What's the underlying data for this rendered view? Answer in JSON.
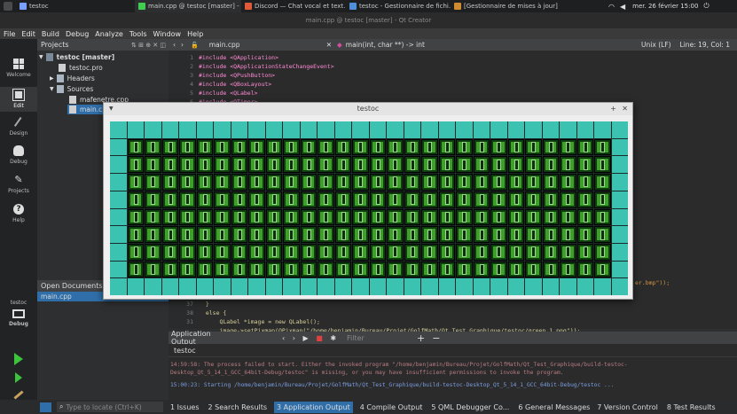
{
  "system_panel": {
    "tasks": [
      {
        "label": "testoc",
        "color": "#7aa0ff"
      },
      {
        "label": "main.cpp @ testoc [master] - ...",
        "color": "#41cd52"
      },
      {
        "label": "Discord — Chat vocal et text...",
        "color": "#e05a3a"
      },
      {
        "label": "testoc - Gestionnaire de fichi...",
        "color": "#4f8fd8"
      },
      {
        "label": "[Gestionnaire de mises à jour]",
        "color": "#d08a30"
      }
    ],
    "clock": "mer. 26 février 15:00"
  },
  "window_title": "main.cpp @ testoc [master] - Qt Creator",
  "menu": [
    "File",
    "Edit",
    "Build",
    "Debug",
    "Analyze",
    "Tools",
    "Window",
    "Help"
  ],
  "modes": [
    {
      "label": "Welcome",
      "icon": "welcome-icon"
    },
    {
      "label": "Edit",
      "icon": "edit-icon"
    },
    {
      "label": "Design",
      "icon": "design-icon"
    },
    {
      "label": "Debug",
      "icon": "debug-icon"
    },
    {
      "label": "Projects",
      "icon": "projects-icon"
    },
    {
      "label": "Help",
      "icon": "help-icon"
    }
  ],
  "kit": {
    "project": "testoc",
    "config": "Debug"
  },
  "projects_panel": {
    "title": "Projects",
    "tree": [
      "testoc [master]",
      "testoc.pro",
      "Headers",
      "Sources",
      "mafenetre.cpp",
      "main.cpp"
    ]
  },
  "open_documents": {
    "title": "Open Documents",
    "items": [
      "main.cpp"
    ]
  },
  "editor": {
    "file": "main.cpp",
    "function": "main(int, char **) -> int",
    "encoding": "Unix (LF)",
    "position": "Line: 19, Col: 1",
    "lines": [
      {
        "n": "1",
        "text": "#include <QApplication>"
      },
      {
        "n": "2",
        "text": "#include <QApplicationStateChangeEvent>"
      },
      {
        "n": "3",
        "text": "#include <QPushButton>"
      },
      {
        "n": "4",
        "text": "#include <QBoxLayout>"
      },
      {
        "n": "5",
        "text": "#include <QLabel>"
      },
      {
        "n": "6",
        "text": "#include <QTimer>"
      }
    ],
    "bottom_lines": [
      {
        "n": "",
        "text": "er.bmp\"));"
      },
      {
        "n": "37",
        "text": "  }"
      },
      {
        "n": "38",
        "text": "  else {"
      },
      {
        "n": "31",
        "text": "      QLabel *image = new QLabel();"
      },
      {
        "n": "32",
        "text": "      image->setPixmap(QPixmap(\"/home/benjamin/Bureau/Projet/GolfMath/Qt_Test_Graphique/testoc/green_1.png\"));"
      }
    ]
  },
  "output": {
    "title": "Application Output",
    "filter_placeholder": "Filter",
    "tab": "testoc",
    "lines": [
      "14:59:58: The process failed to start. Either the invoked program \"/home/benjamin/Bureau/Projet/GolfMath/Qt_Test_Graphique/build-testoc-",
      "Desktop_Qt_5_14_1_GCC_64bit-Debug/testoc\" is missing, or you may have insufficient permissions to invoke the program.",
      "15:00:23: Starting /home/benjamin/Bureau/Projet/GolfMath/Qt_Test_Graphique/build-testoc-Desktop_Qt_5_14_1_GCC_64bit-Debug/testoc ..."
    ]
  },
  "statusbar": {
    "locate_placeholder": "Type to locate (Ctrl+K)",
    "tabs": [
      "1 Issues",
      "2 Search Results",
      "3 Application Output",
      "4 Compile Output",
      "5 QML Debugger Co...",
      "6 General Messages",
      "7 Version Control",
      "8 Test Results"
    ]
  },
  "app_window": {
    "title": "testoc"
  },
  "colors": {
    "accent": "#2f6ea8",
    "tile_blue": "#3cc2b0",
    "tile_green": "#3ea02a"
  }
}
